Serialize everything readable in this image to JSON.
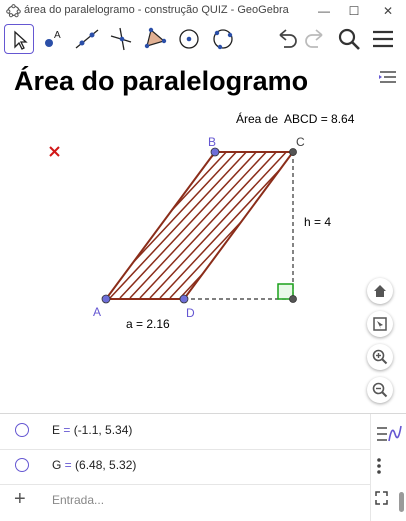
{
  "window": {
    "title": "área do paralelogramo - construção QUIZ - GeoGebra",
    "minimize": "—",
    "maximize": "☐",
    "close": "✕"
  },
  "toolbar": {
    "tools": [
      "move-tool",
      "point-tool",
      "line-tool",
      "perpendicular-tool",
      "polygon-tool",
      "circle-center-tool",
      "circle-three-points-tool"
    ],
    "actions": [
      "undo",
      "redo",
      "search",
      "menu"
    ]
  },
  "graphics": {
    "heading": "Área do paralelogramo",
    "area_label": "Área de  ABCD = 8.64",
    "height_label": "h = 4",
    "base_label": "a = 2.16",
    "points": [
      {
        "name": "A"
      },
      {
        "name": "B"
      },
      {
        "name": "C"
      },
      {
        "name": "D"
      }
    ],
    "fill_color": "#8b2d1a",
    "point_color": "#6e6ed8"
  },
  "algebra": {
    "rows": [
      {
        "text": "E = (-1.1, 5.34)"
      },
      {
        "text": "G = (6.48, 5.32)"
      }
    ],
    "input_placeholder": "Entrada..."
  },
  "colors": {
    "accent": "#6557d2",
    "right_angle": "#1aa11a"
  }
}
